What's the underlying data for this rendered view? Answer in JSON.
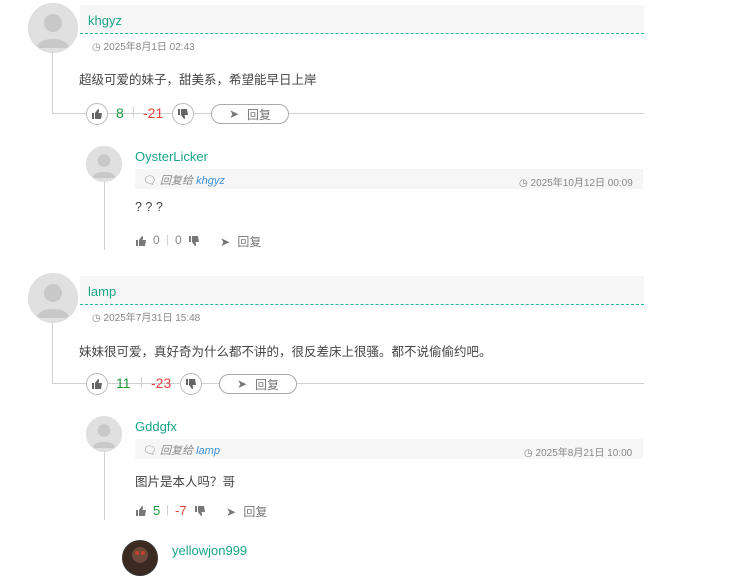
{
  "comments": [
    {
      "name": "khgyz",
      "time": "2025年8月1日 02:43",
      "content": "超级可爱的妹子，甜美系，希望能早日上岸",
      "up": "8",
      "down": "-21",
      "reply_label": "回复",
      "replies": [
        {
          "name": "OysterLicker",
          "reply_prefix": "回复给",
          "reply_to": "khgyz",
          "time": "2025年10月12日 00:09",
          "content": "? ? ?",
          "up": "0",
          "down": "0",
          "reply_label": "回复"
        }
      ]
    },
    {
      "name": "lamp",
      "time": "2025年7月31日 15:48",
      "content": "妹妹很可爱，真好奇为什么都不讲的，很反差床上很骚。都不说偷偷约吧。",
      "up": "11",
      "down": "-23",
      "reply_label": "回复",
      "replies": [
        {
          "name": "Gddgfx",
          "reply_prefix": "回复给",
          "reply_to": "lamp",
          "time": "2025年8月21日 10:00",
          "content": "图片是本人吗？哥",
          "up": "5",
          "down": "-7",
          "reply_label": "回复"
        }
      ]
    },
    {
      "name": "yellowjon999"
    }
  ],
  "colors": {
    "name": "#1aa58a",
    "up": "#1e9a3c",
    "down": "#e0463a",
    "reply_to": "#3a8fd8"
  }
}
